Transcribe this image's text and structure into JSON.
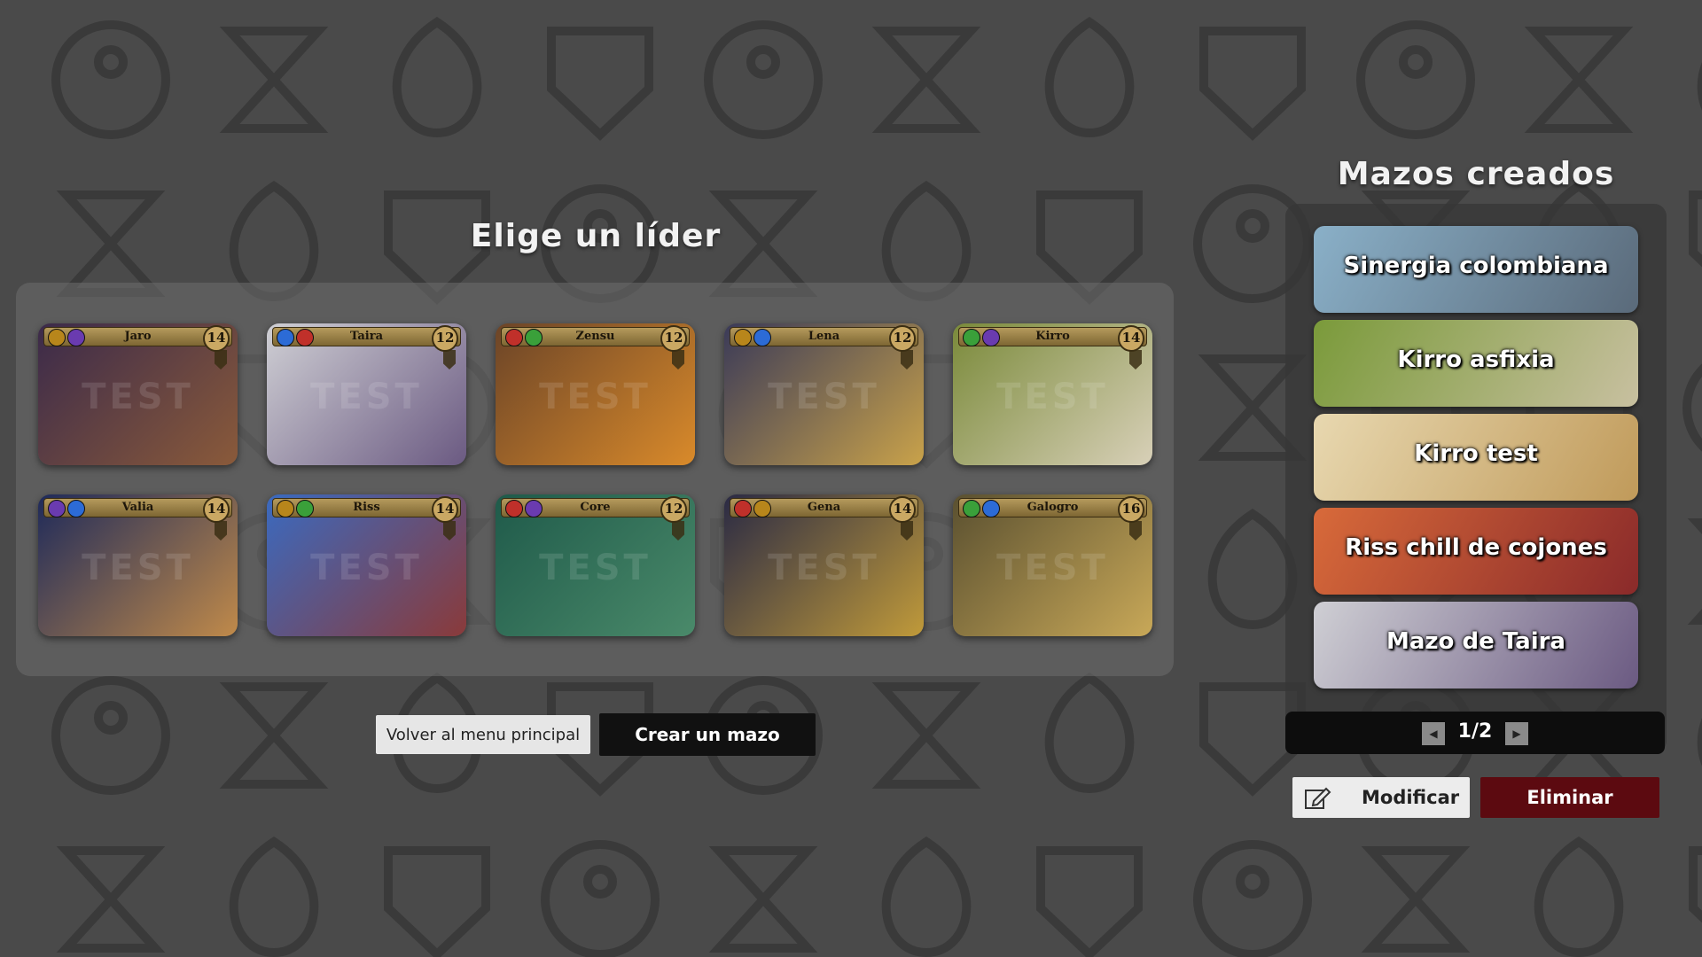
{
  "leader_selection": {
    "title": "Elige un líder",
    "watermark": "TEST",
    "cards": [
      {
        "name": "Jaro",
        "cost": "14",
        "emblems": [
          "#b8861b",
          "#6a3bb0"
        ],
        "art": [
          "#3b2a4a",
          "#8a5a3a"
        ]
      },
      {
        "name": "Taira",
        "cost": "12",
        "emblems": [
          "#2c6bd6",
          "#c0302a"
        ],
        "art": [
          "#cfcfd4",
          "#6b5a82"
        ]
      },
      {
        "name": "Zensu",
        "cost": "12",
        "emblems": [
          "#c0302a",
          "#3aa03a"
        ],
        "art": [
          "#6b4428",
          "#d98a2a"
        ]
      },
      {
        "name": "Lena",
        "cost": "12",
        "emblems": [
          "#b8861b",
          "#2c6bd6"
        ],
        "art": [
          "#3a3a58",
          "#c9a24a"
        ]
      },
      {
        "name": "Kirro",
        "cost": "14",
        "emblems": [
          "#3aa03a",
          "#6a3bb0"
        ],
        "art": [
          "#7a8a3a",
          "#d8d0b8"
        ]
      },
      {
        "name": "Valia",
        "cost": "14",
        "emblems": [
          "#6a3bb0",
          "#2c6bd6"
        ],
        "art": [
          "#1e2a5a",
          "#c08a4a"
        ]
      },
      {
        "name": "Riss",
        "cost": "14",
        "emblems": [
          "#b8861b",
          "#3aa03a"
        ],
        "art": [
          "#3a6ac0",
          "#8a3a3a"
        ]
      },
      {
        "name": "Core",
        "cost": "12",
        "emblems": [
          "#c0302a",
          "#6a3bb0"
        ],
        "art": [
          "#1f5a4a",
          "#4a8a6a"
        ]
      },
      {
        "name": "Gena",
        "cost": "14",
        "emblems": [
          "#c0302a",
          "#b8861b"
        ],
        "art": [
          "#2a2a44",
          "#c09a3a"
        ]
      },
      {
        "name": "Galogro",
        "cost": "16",
        "emblems": [
          "#3aa03a",
          "#2c6bd6"
        ],
        "art": [
          "#5a5030",
          "#c8a858"
        ]
      }
    ]
  },
  "buttons": {
    "back_label": "Volver al menu principal",
    "create_label": "Crear un mazo",
    "modify_label": "Modificar",
    "delete_label": "Eliminar"
  },
  "decks": {
    "title": "Mazos creados",
    "items": [
      {
        "label": "Sinergia colombiana",
        "art": [
          "#8ab0c8",
          "#5a6a7a"
        ]
      },
      {
        "label": "Kirro asfixia",
        "art": [
          "#7a9a3a",
          "#c8c0a0"
        ]
      },
      {
        "label": "Kirro test",
        "art": [
          "#e8d8b0",
          "#c09a5a"
        ]
      },
      {
        "label": "Riss chill de cojones",
        "art": [
          "#d86a3a",
          "#8a2a2a"
        ]
      },
      {
        "label": "Mazo de Taira",
        "art": [
          "#cfcfd4",
          "#6b5a82"
        ]
      }
    ],
    "pager": {
      "indicator": "1/2"
    }
  },
  "colors": {
    "background": "#4a4a4a",
    "delete_button": "#5c0a10",
    "create_button": "#111111"
  }
}
